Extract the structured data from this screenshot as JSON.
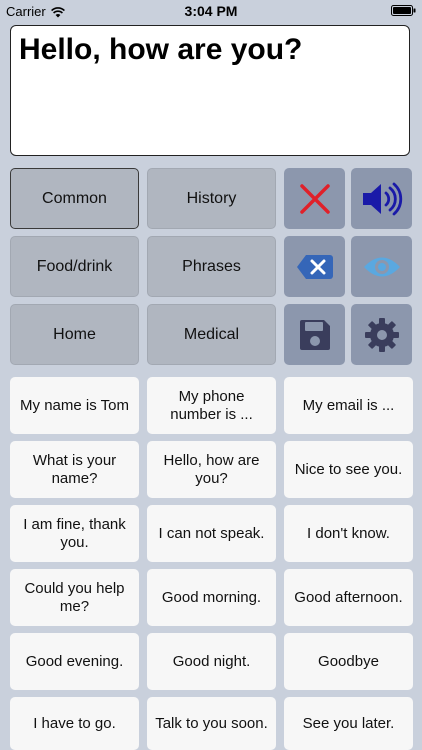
{
  "status_bar": {
    "carrier": "Carrier",
    "time": "3:04 PM"
  },
  "text_box": {
    "value": "Hello, how are you?"
  },
  "categories": [
    {
      "label": "Common"
    },
    {
      "label": "History"
    },
    {
      "label": "Food/drink"
    },
    {
      "label": "Phrases"
    },
    {
      "label": "Home"
    },
    {
      "label": "Medical"
    }
  ],
  "actions": {
    "clear_icon": "close-icon",
    "speak_icon": "speaker-icon",
    "backspace_icon": "backspace-icon",
    "show_icon": "eye-icon",
    "save_icon": "floppy-disk-icon",
    "settings_icon": "gear-icon"
  },
  "phrases": [
    {
      "label": "My name is Tom"
    },
    {
      "label": "My phone number is ..."
    },
    {
      "label": "My email is ..."
    },
    {
      "label": "What is your name?"
    },
    {
      "label": "Hello, how are you?"
    },
    {
      "label": "Nice to see you."
    },
    {
      "label": "I am fine, thank you."
    },
    {
      "label": "I can not speak."
    },
    {
      "label": "I don't know."
    },
    {
      "label": "Could you help me?"
    },
    {
      "label": "Good morning."
    },
    {
      "label": "Good afternoon."
    },
    {
      "label": "Good evening."
    },
    {
      "label": "Good night."
    },
    {
      "label": "Goodbye"
    },
    {
      "label": "I have to go."
    },
    {
      "label": "Talk to you soon."
    },
    {
      "label": "See you later."
    }
  ],
  "colors": {
    "background": "#c9d0dc",
    "category_button": "#b0b6c0",
    "action_button": "#8c97ad",
    "phrase_button": "#f7f7f7",
    "clear_red": "#e0202a",
    "speaker_blue": "#1a1aa8",
    "backspace_blue": "#3566b8",
    "eye_blue": "#5aa8e0",
    "dark_icon": "#3a3d5c"
  }
}
